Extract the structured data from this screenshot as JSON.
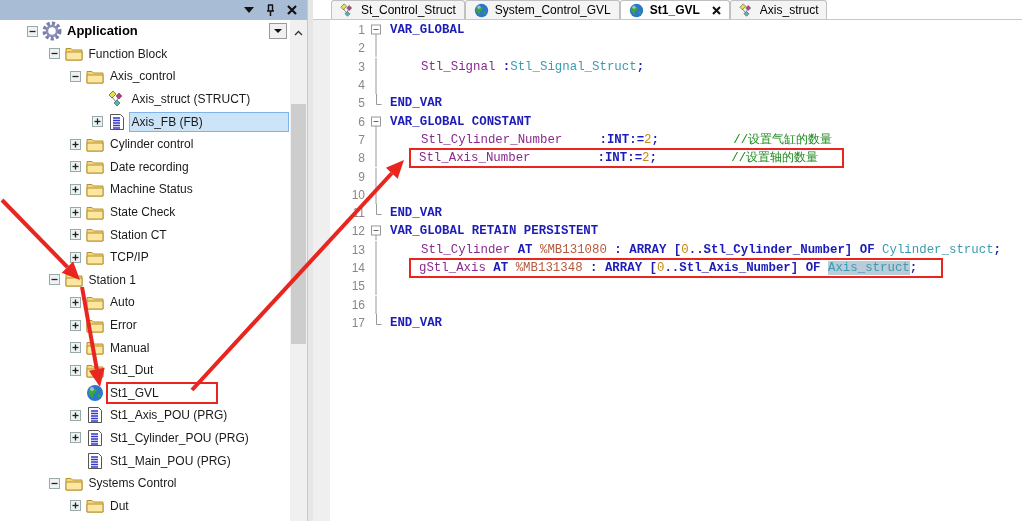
{
  "panel": {
    "tree": [
      {
        "label": "Application",
        "kind": "gear",
        "expanded": true,
        "selected": false,
        "children": [
          {
            "label": "Function Block",
            "kind": "folder",
            "expanded": true,
            "selected": false,
            "children": [
              {
                "label": "Axis_control",
                "kind": "folder",
                "expanded": true,
                "selected": false,
                "children": [
                  {
                    "label": "Axis_struct (STRUCT)",
                    "kind": "struct",
                    "selected": false
                  },
                  {
                    "label": "Axis_FB (FB)",
                    "kind": "pou",
                    "expanded": false,
                    "selected": true
                  }
                ]
              },
              {
                "label": "Cylinder control",
                "kind": "folder",
                "expanded": false,
                "selected": false
              },
              {
                "label": "Date  recording",
                "kind": "folder",
                "expanded": false,
                "selected": false
              },
              {
                "label": "Machine Status",
                "kind": "folder",
                "expanded": false,
                "selected": false
              },
              {
                "label": "State Check",
                "kind": "folder",
                "expanded": false,
                "selected": false
              },
              {
                "label": "Station CT",
                "kind": "folder",
                "expanded": false,
                "selected": false
              },
              {
                "label": "TCP/IP",
                "kind": "folder",
                "expanded": false,
                "selected": false
              }
            ]
          },
          {
            "label": "Station 1",
            "kind": "folder",
            "expanded": true,
            "selected": false,
            "children": [
              {
                "label": "Auto",
                "kind": "folder",
                "expanded": false,
                "selected": false
              },
              {
                "label": "Error",
                "kind": "folder",
                "expanded": false,
                "selected": false
              },
              {
                "label": "Manual",
                "kind": "folder",
                "expanded": false,
                "selected": false
              },
              {
                "label": "St1_Dut",
                "kind": "folder",
                "expanded": false,
                "selected": false
              },
              {
                "label": "St1_GVL",
                "kind": "gvl",
                "selected": false,
                "highlighted": true
              },
              {
                "label": "St1_Axis_POU (PRG)",
                "kind": "pou",
                "expanded": false,
                "selected": false
              },
              {
                "label": "St1_Cylinder_POU (PRG)",
                "kind": "pou",
                "expanded": false,
                "selected": false
              },
              {
                "label": "St1_Main_POU (PRG)",
                "kind": "pou",
                "selected": false
              }
            ]
          },
          {
            "label": "Systems Control",
            "kind": "folder",
            "expanded": true,
            "selected": false,
            "children": [
              {
                "label": "Dut",
                "kind": "folder",
                "expanded": false,
                "selected": false
              }
            ]
          }
        ]
      }
    ]
  },
  "editor": {
    "tabs": [
      {
        "label": "St_Control_Struct",
        "kind": "struct",
        "selected": false
      },
      {
        "label": "System_Control_GVL",
        "kind": "gvl",
        "selected": false
      },
      {
        "label": "St1_GVL",
        "kind": "gvl",
        "selected": true
      },
      {
        "label": "Axis_struct",
        "kind": "struct",
        "selected": false
      }
    ],
    "lines": [
      {
        "number": "1",
        "kind": "start",
        "tokens": [
          {
            "kind": "keyword",
            "text": "VAR_GLOBAL"
          }
        ]
      },
      {
        "number": "2",
        "kind": "inside"
      },
      {
        "number": "3",
        "kind": "inside",
        "indented": true,
        "tokens": [
          {
            "kind": "variable",
            "text": "Stl_Signal "
          },
          {
            "kind": "keyword",
            "text": ":"
          },
          {
            "kind": "type",
            "text": "Stl_Signal_Struct"
          },
          {
            "kind": "keyword",
            "text": ";"
          }
        ]
      },
      {
        "number": "4",
        "kind": "inside"
      },
      {
        "number": "5",
        "kind": "end",
        "tokens": [
          {
            "kind": "keyword",
            "text": "END_VAR"
          }
        ]
      },
      {
        "number": "6",
        "kind": "start",
        "tokens": [
          {
            "kind": "keyword",
            "text": "VAR_GLOBAL CONSTANT"
          }
        ]
      },
      {
        "number": "7",
        "kind": "inside",
        "indented": true,
        "tokens": [
          {
            "kind": "variable",
            "text": "Stl_Cylinder_Number     "
          },
          {
            "kind": "keyword",
            "text": ":INT:="
          },
          {
            "kind": "number",
            "text": "2"
          },
          {
            "kind": "keyword",
            "text": ";          "
          },
          {
            "kind": "comment",
            "text": "//设置气缸的数量"
          }
        ]
      },
      {
        "number": "8",
        "kind": "inside",
        "indented": true,
        "highlighted": true,
        "tokens": [
          {
            "kind": "variable",
            "text": "Stl_Axis_Number         "
          },
          {
            "kind": "keyword",
            "text": ":INT:="
          },
          {
            "kind": "number",
            "text": "2"
          },
          {
            "kind": "keyword",
            "text": ";          "
          },
          {
            "kind": "comment",
            "text": "//设置轴的数量"
          }
        ]
      },
      {
        "number": "9",
        "kind": "inside"
      },
      {
        "number": "10",
        "kind": "inside"
      },
      {
        "number": "11",
        "kind": "end",
        "tokens": [
          {
            "kind": "keyword",
            "text": "END_VAR"
          }
        ]
      },
      {
        "number": "12",
        "kind": "start",
        "tokens": [
          {
            "kind": "keyword",
            "text": "VAR_GLOBAL RETAIN PERSISTENT"
          }
        ]
      },
      {
        "number": "13",
        "kind": "inside",
        "indented": true,
        "tokens": [
          {
            "kind": "variable",
            "text": "Stl_Cylinder "
          },
          {
            "kind": "keyword",
            "text": "AT "
          },
          {
            "kind": "address",
            "text": "%MB131080"
          },
          {
            "kind": "keyword",
            "text": " : ARRAY ["
          },
          {
            "kind": "number",
            "text": "0"
          },
          {
            "kind": "keyword",
            "text": "..Stl_Cylinder_Number] OF "
          },
          {
            "kind": "type",
            "text": "Cylinder_struct"
          },
          {
            "kind": "keyword",
            "text": ";"
          }
        ]
      },
      {
        "number": "14",
        "kind": "inside",
        "indented": true,
        "highlighted": true,
        "tokens": [
          {
            "kind": "variable",
            "text": "gStl_Axis "
          },
          {
            "kind": "keyword",
            "text": "AT "
          },
          {
            "kind": "address",
            "text": "%MB131348"
          },
          {
            "kind": "keyword",
            "text": " : ARRAY ["
          },
          {
            "kind": "number",
            "text": "0"
          },
          {
            "kind": "keyword",
            "text": "..Stl_Axis_Number] OF "
          },
          {
            "kind": "type",
            "text": "Axis_struct",
            "highlighted": true
          },
          {
            "kind": "keyword",
            "text": ";"
          }
        ]
      },
      {
        "number": "15",
        "kind": "inside"
      },
      {
        "number": "16",
        "kind": "inside"
      },
      {
        "number": "17",
        "kind": "end",
        "tokens": [
          {
            "kind": "keyword",
            "text": "END_VAR"
          }
        ]
      }
    ]
  }
}
